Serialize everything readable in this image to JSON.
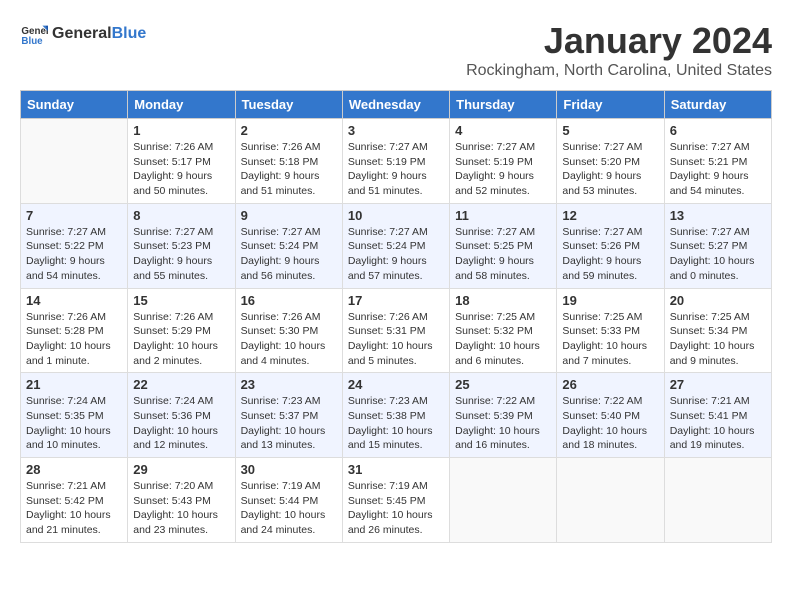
{
  "header": {
    "logo_general": "General",
    "logo_blue": "Blue",
    "month_title": "January 2024",
    "location": "Rockingham, North Carolina, United States"
  },
  "weekdays": [
    "Sunday",
    "Monday",
    "Tuesday",
    "Wednesday",
    "Thursday",
    "Friday",
    "Saturday"
  ],
  "weeks": [
    [
      {
        "day": "",
        "info": ""
      },
      {
        "day": "1",
        "info": "Sunrise: 7:26 AM\nSunset: 5:17 PM\nDaylight: 9 hours\nand 50 minutes."
      },
      {
        "day": "2",
        "info": "Sunrise: 7:26 AM\nSunset: 5:18 PM\nDaylight: 9 hours\nand 51 minutes."
      },
      {
        "day": "3",
        "info": "Sunrise: 7:27 AM\nSunset: 5:19 PM\nDaylight: 9 hours\nand 51 minutes."
      },
      {
        "day": "4",
        "info": "Sunrise: 7:27 AM\nSunset: 5:19 PM\nDaylight: 9 hours\nand 52 minutes."
      },
      {
        "day": "5",
        "info": "Sunrise: 7:27 AM\nSunset: 5:20 PM\nDaylight: 9 hours\nand 53 minutes."
      },
      {
        "day": "6",
        "info": "Sunrise: 7:27 AM\nSunset: 5:21 PM\nDaylight: 9 hours\nand 54 minutes."
      }
    ],
    [
      {
        "day": "7",
        "info": "Sunrise: 7:27 AM\nSunset: 5:22 PM\nDaylight: 9 hours\nand 54 minutes."
      },
      {
        "day": "8",
        "info": "Sunrise: 7:27 AM\nSunset: 5:23 PM\nDaylight: 9 hours\nand 55 minutes."
      },
      {
        "day": "9",
        "info": "Sunrise: 7:27 AM\nSunset: 5:24 PM\nDaylight: 9 hours\nand 56 minutes."
      },
      {
        "day": "10",
        "info": "Sunrise: 7:27 AM\nSunset: 5:24 PM\nDaylight: 9 hours\nand 57 minutes."
      },
      {
        "day": "11",
        "info": "Sunrise: 7:27 AM\nSunset: 5:25 PM\nDaylight: 9 hours\nand 58 minutes."
      },
      {
        "day": "12",
        "info": "Sunrise: 7:27 AM\nSunset: 5:26 PM\nDaylight: 9 hours\nand 59 minutes."
      },
      {
        "day": "13",
        "info": "Sunrise: 7:27 AM\nSunset: 5:27 PM\nDaylight: 10 hours\nand 0 minutes."
      }
    ],
    [
      {
        "day": "14",
        "info": "Sunrise: 7:26 AM\nSunset: 5:28 PM\nDaylight: 10 hours\nand 1 minute."
      },
      {
        "day": "15",
        "info": "Sunrise: 7:26 AM\nSunset: 5:29 PM\nDaylight: 10 hours\nand 2 minutes."
      },
      {
        "day": "16",
        "info": "Sunrise: 7:26 AM\nSunset: 5:30 PM\nDaylight: 10 hours\nand 4 minutes."
      },
      {
        "day": "17",
        "info": "Sunrise: 7:26 AM\nSunset: 5:31 PM\nDaylight: 10 hours\nand 5 minutes."
      },
      {
        "day": "18",
        "info": "Sunrise: 7:25 AM\nSunset: 5:32 PM\nDaylight: 10 hours\nand 6 minutes."
      },
      {
        "day": "19",
        "info": "Sunrise: 7:25 AM\nSunset: 5:33 PM\nDaylight: 10 hours\nand 7 minutes."
      },
      {
        "day": "20",
        "info": "Sunrise: 7:25 AM\nSunset: 5:34 PM\nDaylight: 10 hours\nand 9 minutes."
      }
    ],
    [
      {
        "day": "21",
        "info": "Sunrise: 7:24 AM\nSunset: 5:35 PM\nDaylight: 10 hours\nand 10 minutes."
      },
      {
        "day": "22",
        "info": "Sunrise: 7:24 AM\nSunset: 5:36 PM\nDaylight: 10 hours\nand 12 minutes."
      },
      {
        "day": "23",
        "info": "Sunrise: 7:23 AM\nSunset: 5:37 PM\nDaylight: 10 hours\nand 13 minutes."
      },
      {
        "day": "24",
        "info": "Sunrise: 7:23 AM\nSunset: 5:38 PM\nDaylight: 10 hours\nand 15 minutes."
      },
      {
        "day": "25",
        "info": "Sunrise: 7:22 AM\nSunset: 5:39 PM\nDaylight: 10 hours\nand 16 minutes."
      },
      {
        "day": "26",
        "info": "Sunrise: 7:22 AM\nSunset: 5:40 PM\nDaylight: 10 hours\nand 18 minutes."
      },
      {
        "day": "27",
        "info": "Sunrise: 7:21 AM\nSunset: 5:41 PM\nDaylight: 10 hours\nand 19 minutes."
      }
    ],
    [
      {
        "day": "28",
        "info": "Sunrise: 7:21 AM\nSunset: 5:42 PM\nDaylight: 10 hours\nand 21 minutes."
      },
      {
        "day": "29",
        "info": "Sunrise: 7:20 AM\nSunset: 5:43 PM\nDaylight: 10 hours\nand 23 minutes."
      },
      {
        "day": "30",
        "info": "Sunrise: 7:19 AM\nSunset: 5:44 PM\nDaylight: 10 hours\nand 24 minutes."
      },
      {
        "day": "31",
        "info": "Sunrise: 7:19 AM\nSunset: 5:45 PM\nDaylight: 10 hours\nand 26 minutes."
      },
      {
        "day": "",
        "info": ""
      },
      {
        "day": "",
        "info": ""
      },
      {
        "day": "",
        "info": ""
      }
    ]
  ]
}
